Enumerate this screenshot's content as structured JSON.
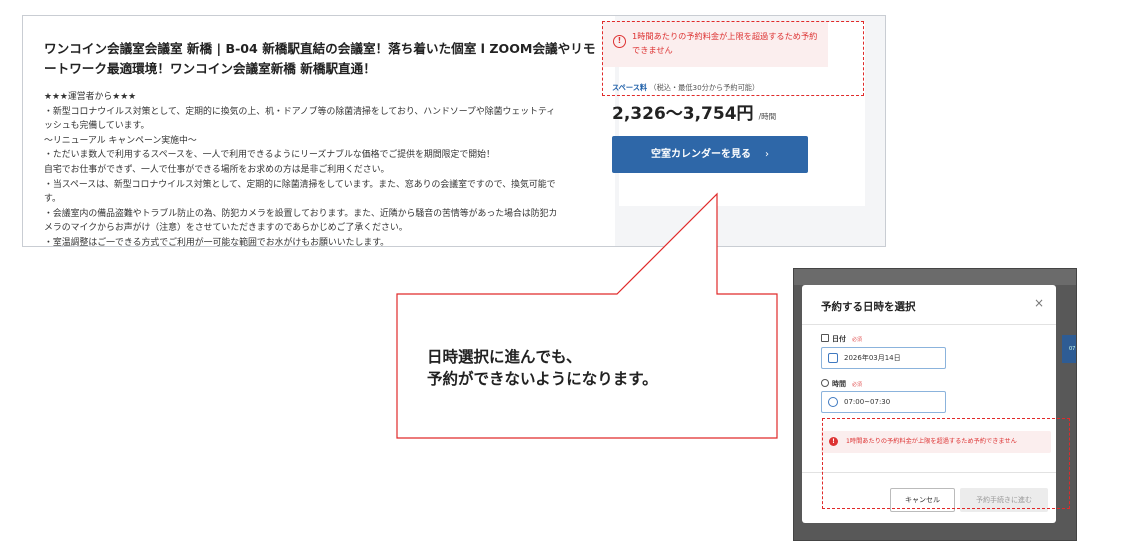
{
  "listing": {
    "title": "ワンコイン会議室会議室 新橋 | B-04 新橋駅直結の会議室！落ち着いた個室 l ZOOM会議やリモートワーク最適環境！ワンコイン会議室新橋 新橋駅直通！",
    "description_lines": [
      "★★★運営者から★★★",
      "・新型コロナウイルス対策として、定期的に換気の上、机・ドアノブ等の除菌清掃をしており、ハンドソープや除菌ウェットティ",
      "ッシュも完備しています。",
      "〜リニューアル キャンペーン実施中〜",
      "・ただいま数人で利用するスペースを、一人で利用できるようにリーズナブルな価格でご提供を期間限定で開始！",
      "自宅でお仕事ができず、一人で仕事ができる場所をお求めの方は是非ご利用ください。",
      "・当スペースは、新型コロナウイルス対策として、定期的に除菌清掃をしています。また、窓ありの会議室ですので、換気可能で",
      "す。",
      "・会議室内の備品盗難やトラブル防止の為、防犯カメラを設置しております。また、近隣から騒音の苦情等があった場合は防犯カ",
      "メラのマイクからお声がけ（注意）をさせていただきますのであらかじめご了承ください。",
      "・室温調整はご一できる方式でご利用が一可能な範囲でお水がけもお願いいたします。"
    ],
    "error_message": "1時間あたりの予約料金が上限を超過するため予約できません",
    "space_fee_label": "スペース料",
    "space_fee_note": "（税込・最低30分から予約可能）",
    "price": "2,326〜3,754円",
    "price_unit": "/時間",
    "calendar_button": "空室カレンダーを見る",
    "calendar_button_chevron": "›"
  },
  "callout": {
    "line1": "日時選択に進んでも、",
    "line2": "予約ができないようになります。"
  },
  "modal": {
    "title": "予約する日時を選択",
    "close": "×",
    "date_label": "日付",
    "time_label": "時間",
    "required": "必須",
    "date_value": "2026年03月14日",
    "time_value": "07:00~07:30",
    "error": "1時間あたりの予約料金が上限を超過するため予約できません",
    "cancel": "キャンセル",
    "proceed": "予約手続きに進む",
    "background_time": "07:"
  },
  "colors": {
    "primary": "#2e67a8",
    "error": "#d33333",
    "error_bg": "#fbeeee",
    "callout_border": "#e02a2a"
  }
}
